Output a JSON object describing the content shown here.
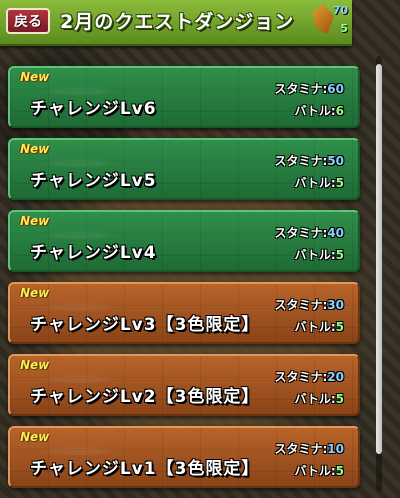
{
  "header": {
    "back_label": "戻る",
    "title": "2月のクエストダンジョン",
    "partial_stamina": "70",
    "partial_battle": "5"
  },
  "quests": [
    {
      "badge": "New",
      "name": "チャレンジLv6",
      "stamina_label": "スタミナ:",
      "stamina": "60",
      "battle_label": "バトル:",
      "battle": "6",
      "theme": "green"
    },
    {
      "badge": "New",
      "name": "チャレンジLv5",
      "stamina_label": "スタミナ:",
      "stamina": "50",
      "battle_label": "バトル:",
      "battle": "5",
      "theme": "green"
    },
    {
      "badge": "New",
      "name": "チャレンジLv4",
      "stamina_label": "スタミナ:",
      "stamina": "40",
      "battle_label": "バトル:",
      "battle": "5",
      "theme": "green"
    },
    {
      "badge": "New",
      "name": "チャレンジLv3【3色限定】",
      "stamina_label": "スタミナ:",
      "stamina": "30",
      "battle_label": "バトル:",
      "battle": "5",
      "theme": "brown"
    },
    {
      "badge": "New",
      "name": "チャレンジLv2【3色限定】",
      "stamina_label": "スタミナ:",
      "stamina": "20",
      "battle_label": "バトル:",
      "battle": "5",
      "theme": "brown"
    },
    {
      "badge": "New",
      "name": "チャレンジLv1【3色限定】",
      "stamina_label": "スタミナ:",
      "stamina": "10",
      "battle_label": "バトル:",
      "battle": "5",
      "theme": "brown"
    }
  ],
  "colors": {
    "header": "#6ea42a",
    "green_item": "#2f8f4a",
    "brown_item": "#a85a24",
    "stamina_value": "#8ad4ff",
    "battle_value": "#9aff8a",
    "new_badge": "#ffe85a"
  }
}
